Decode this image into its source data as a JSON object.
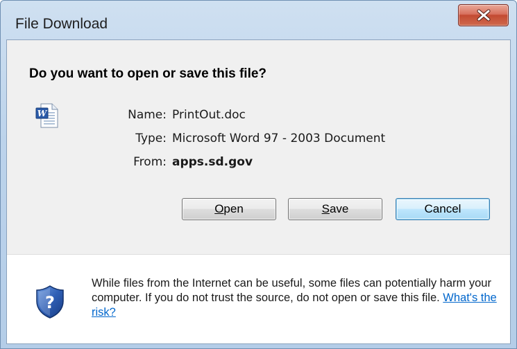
{
  "window": {
    "title": "File Download"
  },
  "dialog": {
    "heading": "Do you want to open or save this file?",
    "file": {
      "name_label": "Name:",
      "name_value": "PrintOut.doc",
      "type_label": "Type:",
      "type_value": "Microsoft Word 97 - 2003 Document",
      "from_label": "From:",
      "from_value": "apps.sd.gov"
    },
    "buttons": {
      "open_mnemonic": "O",
      "open_rest": "pen",
      "save_mnemonic": "S",
      "save_rest": "ave",
      "cancel": "Cancel"
    },
    "warning": {
      "text": "While files from the Internet can be useful, some files can potentially harm your computer. If you do not trust the source, do not open or save this file.",
      "link": "What's the risk?"
    }
  },
  "icons": {
    "document": "word-document-icon",
    "shield": "security-shield-icon",
    "close": "close-icon"
  },
  "colors": {
    "link": "#0066cc",
    "close_button": "#c94f38",
    "default_button_border": "#3c7fb1",
    "shield": "#2f5fb5"
  }
}
